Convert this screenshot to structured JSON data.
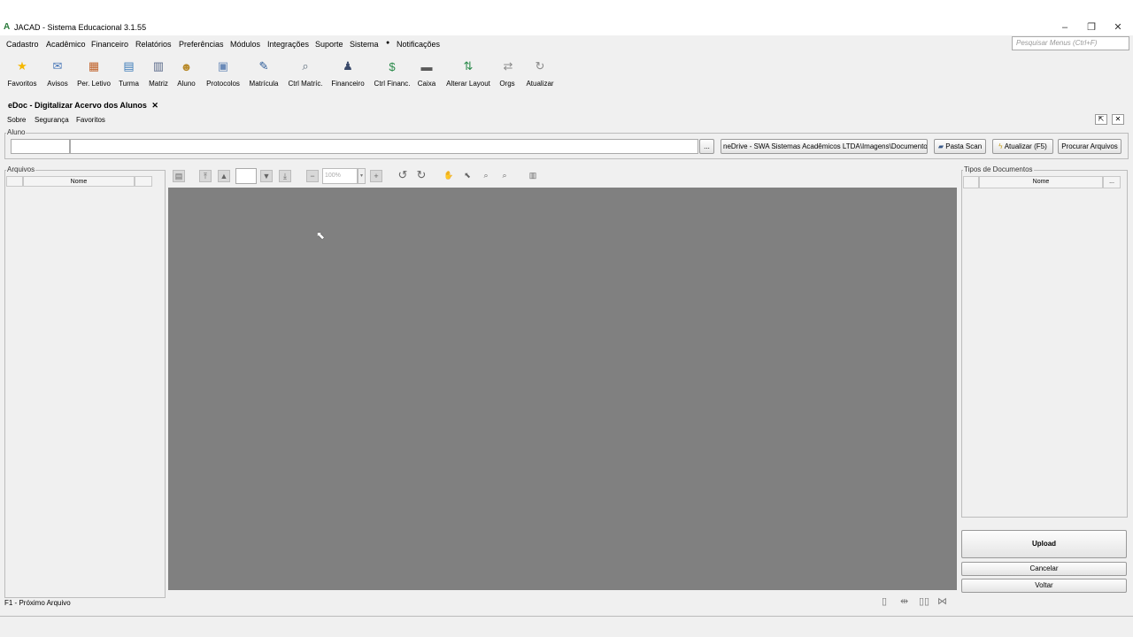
{
  "window": {
    "title": "JACAD - Sistema Educacional 3.1.55",
    "logo": "A",
    "minimize": "–",
    "restore": "❐",
    "close": "✕"
  },
  "menu": {
    "items": [
      "Cadastro",
      "Acadêmico",
      "Financeiro",
      "Relatórios",
      "Preferências",
      "Módulos",
      "Integrações",
      "Suporte",
      "Sistema",
      "Notificações"
    ],
    "search_placeholder": "Pesquisar Menus (Ctrl+F)"
  },
  "toolbar": [
    {
      "label": "Favoritos",
      "icon": "star-icon",
      "glyph": "★",
      "color": "#f5b800"
    },
    {
      "label": "Avisos",
      "icon": "envelope-icon",
      "glyph": "✉",
      "color": "#4a78b8"
    },
    {
      "label": "Per. Letivo",
      "icon": "calendar-icon",
      "glyph": "▦",
      "color": "#c0622a"
    },
    {
      "label": "Turma",
      "icon": "class-icon",
      "glyph": "▤",
      "color": "#3a7ab8"
    },
    {
      "label": "Matriz",
      "icon": "document-icon",
      "glyph": "▥",
      "color": "#5a6a8a"
    },
    {
      "label": "Aluno",
      "icon": "student-icon",
      "glyph": "☻",
      "color": "#b88a2a"
    },
    {
      "label": "Protocolos",
      "icon": "protocol-icon",
      "glyph": "▣",
      "color": "#6a8ab8"
    },
    {
      "label": "Matrícula",
      "icon": "enrollment-icon",
      "glyph": "✎",
      "color": "#2a5a98"
    },
    {
      "label": "Ctrl Matríc.",
      "icon": "enrollment-control-icon",
      "glyph": "⌕",
      "color": "#5a6a7a"
    },
    {
      "label": "Financeiro",
      "icon": "finance-user-icon",
      "glyph": "♟",
      "color": "#3a4a6a"
    },
    {
      "label": "Ctrl Financ.",
      "icon": "money-icon",
      "glyph": "$",
      "color": "#2a8a4a"
    },
    {
      "label": "Caixa",
      "icon": "cash-register-icon",
      "glyph": "▬",
      "color": "#5a5a5a"
    },
    {
      "label": "Alterar Layout",
      "icon": "swap-layout-icon",
      "glyph": "⇅",
      "color": "#2a8a4a"
    },
    {
      "label": "Orgs",
      "icon": "arrows-icon",
      "glyph": "⇄",
      "color": "#8a8a8a"
    },
    {
      "label": "Atualizar",
      "icon": "refresh-icon",
      "glyph": "↻",
      "color": "#8a8a8a"
    }
  ],
  "tab": {
    "title": "eDoc - Digitalizar Acervo dos Alunos",
    "close": "✕"
  },
  "submenu": [
    "Sobre",
    "Segurança",
    "Favoritos"
  ],
  "aluno": {
    "label": "Aluno",
    "code": "",
    "name": "",
    "browse": "...",
    "path": "neDrive - SWA Sistemas Acadêmicos LTDA\\Imagens\\Documentos",
    "pasta_scan": "Pasta Scan",
    "atualizar": "Atualizar (F5)",
    "procurar": "Procurar Arquivos"
  },
  "arquivos": {
    "label": "Arquivos",
    "col_nome": "Nome"
  },
  "viewer": {
    "zoom": "100%",
    "page": ""
  },
  "tipos": {
    "label": "Tipos de Documentos",
    "col_nome": "Nome",
    "col_more": "..."
  },
  "actions": {
    "upload": "Upload",
    "cancelar": "Cancelar",
    "voltar": "Voltar"
  },
  "status": {
    "hint": "F1 - Próximo Arquivo"
  }
}
